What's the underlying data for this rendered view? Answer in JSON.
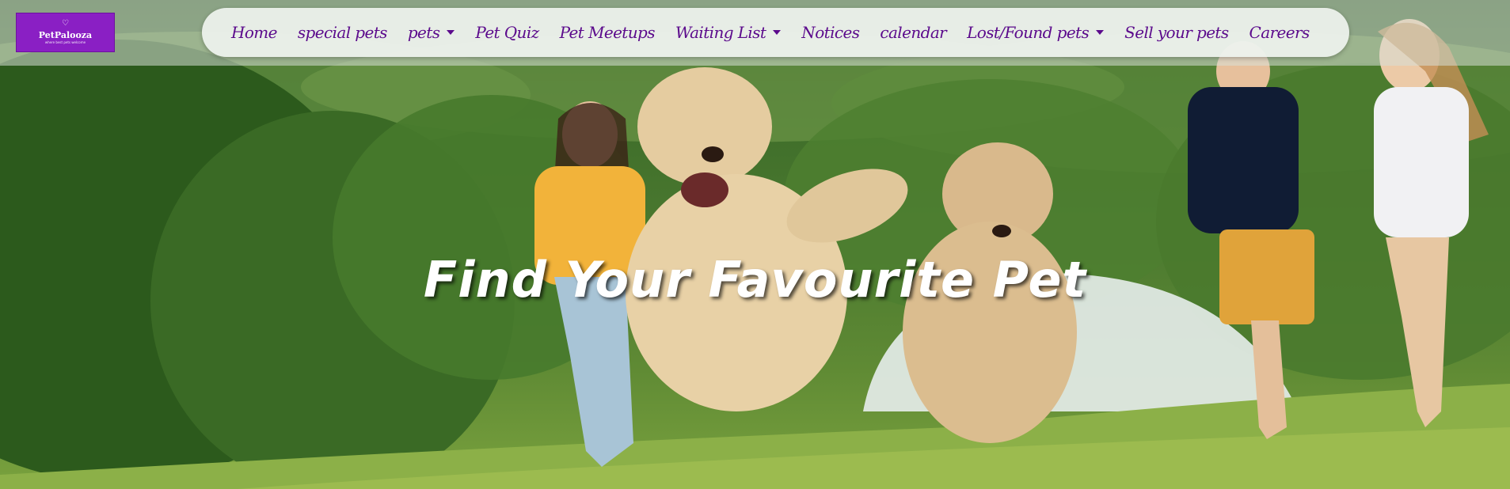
{
  "logo": {
    "mark": "♡",
    "name": "PetPalooza",
    "tagline": "where best pets welcome"
  },
  "nav": {
    "items": [
      {
        "label": "Home",
        "dropdown": false
      },
      {
        "label": "special pets",
        "dropdown": false
      },
      {
        "label": "pets",
        "dropdown": true
      },
      {
        "label": "Pet Quiz",
        "dropdown": false
      },
      {
        "label": "Pet Meetups",
        "dropdown": false
      },
      {
        "label": "Waiting List",
        "dropdown": true
      },
      {
        "label": "Notices",
        "dropdown": false
      },
      {
        "label": "calendar",
        "dropdown": false
      },
      {
        "label": "Lost/Found pets",
        "dropdown": true
      },
      {
        "label": "Sell your pets",
        "dropdown": false
      },
      {
        "label": "Careers",
        "dropdown": false
      }
    ]
  },
  "hero": {
    "headline": "Find Your Favourite Pet"
  },
  "colors": {
    "brand": "#8a1fc4",
    "nav_text": "#5b0a8c",
    "nav_bg": "#eef2ee"
  }
}
